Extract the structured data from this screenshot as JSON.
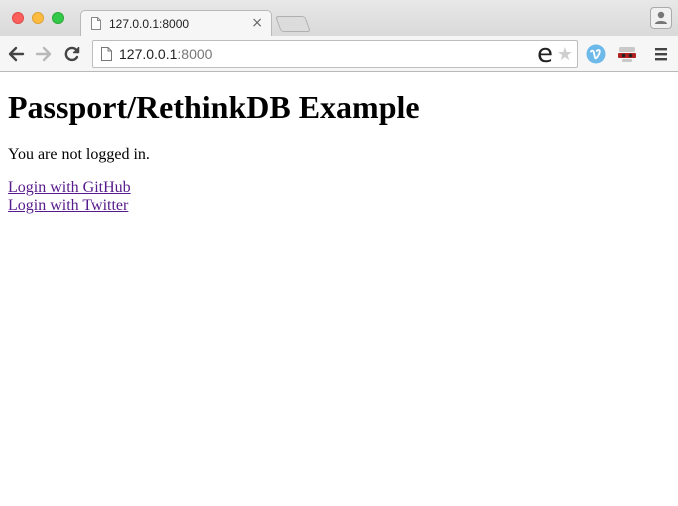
{
  "browser": {
    "tab_title": "127.0.0.1:8000",
    "tab_close": "×",
    "url_host": "127.0.0.1",
    "url_port": ":8000",
    "omnibox_badge": "e",
    "bookmark_star": "★"
  },
  "page": {
    "heading": "Passport/RethinkDB Example",
    "status_text": "You are not logged in.",
    "links": [
      {
        "label": "Login with GitHub"
      },
      {
        "label": "Login with Twitter"
      }
    ]
  },
  "colors": {
    "link_visited": "#551a8b",
    "close_red": "#fc605c",
    "minimize_yellow": "#fdbc40",
    "zoom_green": "#34c84a"
  }
}
